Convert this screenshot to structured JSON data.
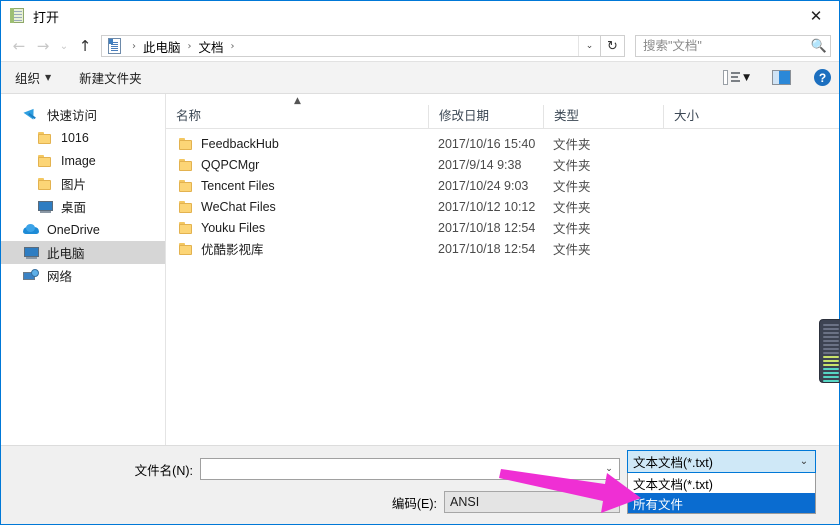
{
  "window": {
    "title": "打开",
    "title_icon": "notepad-document-icon",
    "close_label": "✕"
  },
  "addressbar": {
    "back_icon": "←",
    "forward_icon": "→",
    "history_icon": "⌄",
    "up_icon": "↑",
    "breadcrumb": [
      "此电脑",
      "文档"
    ],
    "breadcrumb_sep": "›",
    "dropdown_icon": "⌄",
    "refresh_icon": "↻"
  },
  "search": {
    "placeholder": "搜索\"文档\"",
    "value": "",
    "icon": "search-icon"
  },
  "commandbar": {
    "organize_label": "组织",
    "organize_caret": "▼",
    "new_folder_label": "新建文件夹",
    "view_icon": "list-view-icon",
    "view_caret": "▼",
    "preview_pane_icon": "preview-pane-icon",
    "help_label": "?"
  },
  "sidebar": {
    "items": [
      {
        "label": "快速访问",
        "icon": "pin-icon",
        "kind": "root",
        "selected": false
      },
      {
        "label": "1016",
        "icon": "folder-icon",
        "kind": "child",
        "selected": false
      },
      {
        "label": "Image",
        "icon": "folder-icon",
        "kind": "child",
        "selected": false
      },
      {
        "label": "图片",
        "icon": "folder-icon",
        "kind": "child",
        "selected": false
      },
      {
        "label": "桌面",
        "icon": "monitor-icon",
        "kind": "child",
        "selected": false
      },
      {
        "label": "OneDrive",
        "icon": "cloud-icon",
        "kind": "root",
        "selected": false
      },
      {
        "label": "此电脑",
        "icon": "monitor-icon",
        "kind": "root",
        "selected": true
      },
      {
        "label": "网络",
        "icon": "network-icon",
        "kind": "root",
        "selected": false
      }
    ]
  },
  "filelist": {
    "sort_indicator": "▲",
    "columns": [
      "名称",
      "修改日期",
      "类型",
      "大小"
    ],
    "rows": [
      {
        "name": "FeedbackHub",
        "date": "2017/10/16 15:40",
        "type": "文件夹",
        "size": ""
      },
      {
        "name": "QQPCMgr",
        "date": "2017/9/14 9:38",
        "type": "文件夹",
        "size": ""
      },
      {
        "name": "Tencent Files",
        "date": "2017/10/24 9:03",
        "type": "文件夹",
        "size": ""
      },
      {
        "name": "WeChat Files",
        "date": "2017/10/12 10:12",
        "type": "文件夹",
        "size": ""
      },
      {
        "name": "Youku Files",
        "date": "2017/10/18 12:54",
        "type": "文件夹",
        "size": ""
      },
      {
        "name": "优酷影视库",
        "date": "2017/10/18 12:54",
        "type": "文件夹",
        "size": ""
      }
    ]
  },
  "footer": {
    "filename_label": "文件名(N):",
    "filename_value": "",
    "filename_caret": "⌄",
    "encoding_label": "编码(E):",
    "encoding_value": "ANSI",
    "filter_selected": "文本文档(*.txt)",
    "filter_caret": "⌄",
    "filter_options": [
      {
        "label": "文本文档(*.txt)",
        "highlighted": false
      },
      {
        "label": "所有文件",
        "highlighted": true
      }
    ]
  },
  "annotation": {
    "arrow_color": "#ef2fd4",
    "arrow_name": "pointer-arrow-to-all-files-option"
  }
}
